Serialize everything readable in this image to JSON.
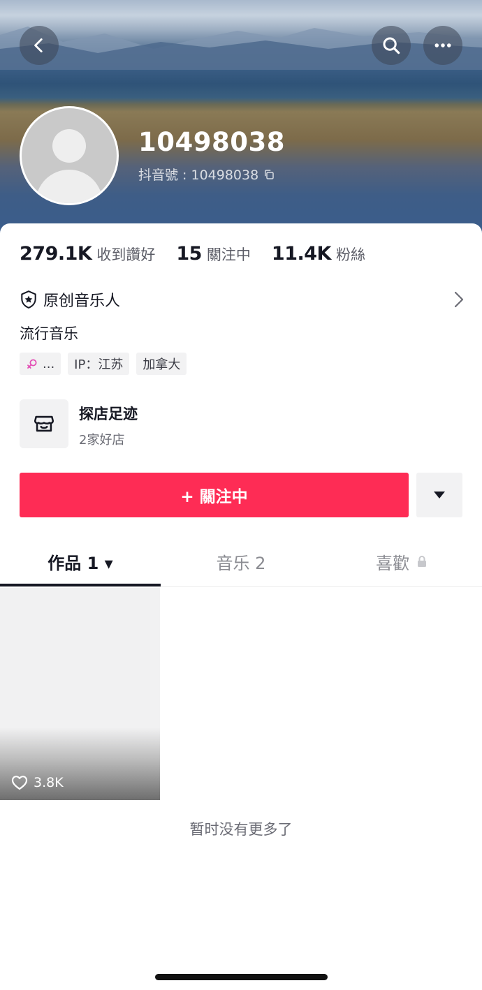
{
  "header": {
    "username": "10498038",
    "douyin_id": "抖音號 : 10498038",
    "back_icon": "chevron-left-icon",
    "search_icon": "search-icon",
    "more_icon": "more-dots-icon"
  },
  "stats": [
    {
      "value": "279.1K",
      "label": "收到讚好"
    },
    {
      "value": "15",
      "label": "關注中"
    },
    {
      "value": "11.4K",
      "label": "粉絲"
    }
  ],
  "badge": {
    "label": "原创音乐人",
    "icon": "award-badge-icon"
  },
  "bio": "流行音乐",
  "tags": [
    {
      "label": "...",
      "icon": "female-icon",
      "icon_color": "#e34fb5"
    },
    {
      "label": "IP：江苏"
    },
    {
      "label": "加拿大"
    }
  ],
  "shop": {
    "title": "探店足迹",
    "subtitle": "2家好店",
    "icon": "store-icon"
  },
  "actions": {
    "follow_label": "+ 關注中",
    "dropdown_icon": "caret-down-icon"
  },
  "tabs": [
    {
      "label": "作品 1 ▾",
      "active": true
    },
    {
      "label": "音乐 2",
      "active": false
    },
    {
      "label": "喜歡",
      "active": false,
      "icon": "lock-icon"
    }
  ],
  "videos": [
    {
      "likes": "3.8K",
      "icon": "heart-outline-icon"
    }
  ],
  "footer_text": "暂时没有更多了",
  "colors": {
    "accent": "#fe2c55",
    "text": "#161823",
    "secondary": "#8a8b91"
  }
}
